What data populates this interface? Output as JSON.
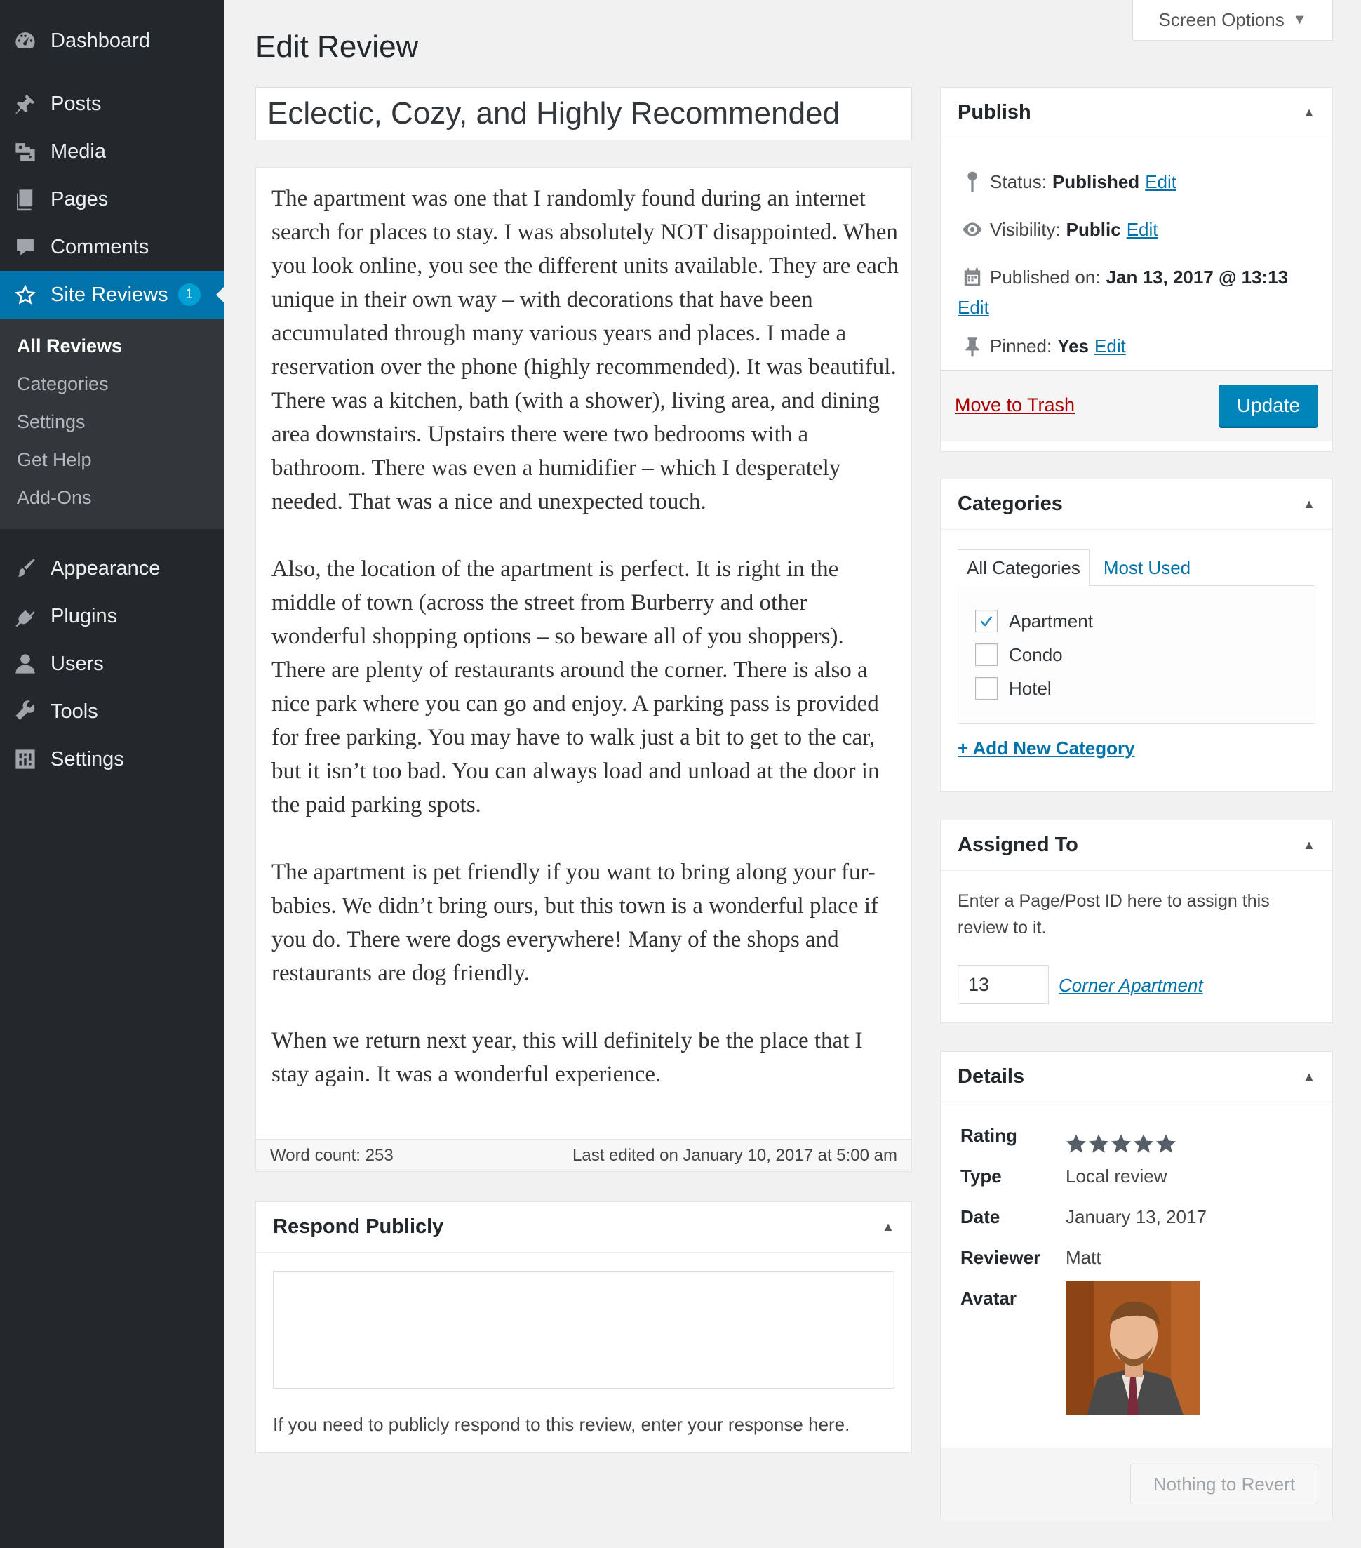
{
  "sidebar": {
    "items": [
      {
        "label": "Dashboard",
        "icon": "dashboard-icon"
      },
      {
        "label": "Posts",
        "icon": "pushpin-icon"
      },
      {
        "label": "Media",
        "icon": "media-icon"
      },
      {
        "label": "Pages",
        "icon": "pages-icon"
      },
      {
        "label": "Comments",
        "icon": "comment-icon"
      },
      {
        "label": "Site Reviews",
        "icon": "star-icon",
        "badge": "1"
      },
      {
        "label": "Appearance",
        "icon": "paintbrush-icon"
      },
      {
        "label": "Plugins",
        "icon": "plugin-icon"
      },
      {
        "label": "Users",
        "icon": "user-icon"
      },
      {
        "label": "Tools",
        "icon": "wrench-icon"
      },
      {
        "label": "Settings",
        "icon": "settings-icon"
      }
    ],
    "submenu": [
      "All Reviews",
      "Categories",
      "Settings",
      "Get Help",
      "Add-Ons"
    ]
  },
  "header": {
    "title": "Edit Review",
    "screen_options": "Screen Options"
  },
  "post": {
    "title": "Eclectic, Cozy, and Highly Recommended",
    "paragraphs": [
      "The apartment was one that I randomly found during an internet search for places to stay. I was absolutely NOT disappointed. When you look online, you see the different units available. They are each unique in their own way – with decorations that have been accumulated through many various years and places. I made a reservation over the phone (highly recommended). It was beautiful. There was a kitchen, bath (with a shower), living area, and dining area downstairs. Upstairs there were two bedrooms with a bathroom. There was even a humidifier – which I desperately needed. That was a nice and unexpected touch.",
      "Also, the location of the apartment is perfect. It is right in the middle of town (across the street from Burberry and other wonderful shopping options – so beware all of you shoppers). There are plenty of restaurants around the corner. There is also a nice park where you can go and enjoy. A parking pass is provided for free parking. You may have to walk just a bit to get to the car, but it isn’t too bad. You can always load and unload at the door in the paid parking spots.",
      "The apartment is pet friendly if you want to bring along your fur-babies. We didn’t bring ours, but this town is a wonderful place if you do. There were dogs everywhere! Many of the shops and restaurants are dog friendly.",
      "When we return next year, this will definitely be the place that I stay again. It was a wonderful experience."
    ],
    "word_count": "Word count: 253",
    "last_edited": "Last edited on January 10, 2017 at 5:00 am"
  },
  "respond": {
    "title": "Respond Publicly",
    "textarea_value": "",
    "help": "If you need to publicly respond to this review, enter your response here."
  },
  "publish": {
    "title": "Publish",
    "status_label": "Status:",
    "status_value": "Published",
    "visibility_label": "Visibility:",
    "visibility_value": "Public",
    "published_label": "Published on:",
    "published_value": "Jan 13, 2017 @ 13:13",
    "pinned_label": "Pinned:",
    "pinned_value": "Yes",
    "edit": "Edit",
    "trash": "Move to Trash",
    "update": "Update"
  },
  "categories": {
    "title": "Categories",
    "tab_all": "All Categories",
    "tab_most": "Most Used",
    "items": [
      {
        "label": "Apartment",
        "checked": true
      },
      {
        "label": "Condo",
        "checked": false
      },
      {
        "label": "Hotel",
        "checked": false
      }
    ],
    "add_new": "+ Add New Category"
  },
  "assigned": {
    "title": "Assigned To",
    "description": "Enter a Page/Post ID here to assign this review to it.",
    "value": "13",
    "link": "Corner Apartment"
  },
  "details": {
    "title": "Details",
    "rating_label": "Rating",
    "rating": 5,
    "rating_max": 5,
    "type_label": "Type",
    "type_value": "Local review",
    "date_label": "Date",
    "date_value": "January 13, 2017",
    "reviewer_label": "Reviewer",
    "reviewer_value": "Matt",
    "avatar_label": "Avatar",
    "revert": "Nothing to Revert"
  },
  "colors": {
    "sidebar_bg": "#23282d",
    "submenu_bg": "#32373c",
    "accent": "#0073aa",
    "button": "#0085ba",
    "trash": "#aa0000",
    "badge": "#00a0d2"
  }
}
